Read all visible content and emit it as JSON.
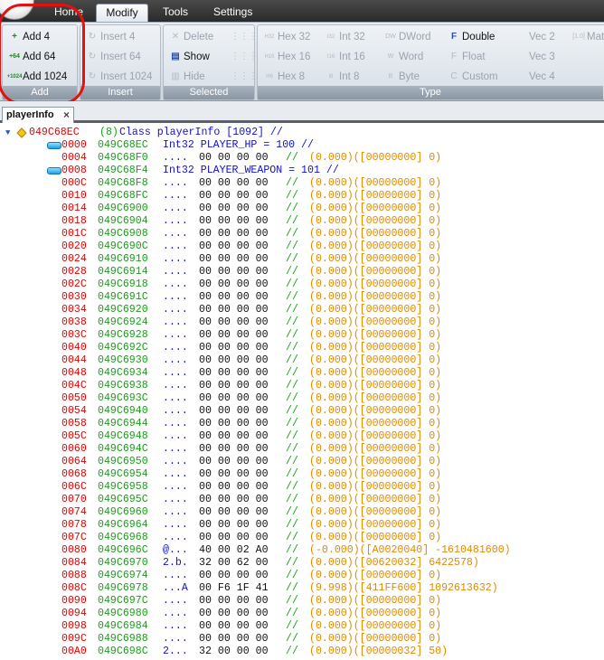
{
  "menu": {
    "tabs": [
      "Home",
      "Modify",
      "Tools",
      "Settings"
    ],
    "active": "Modify"
  },
  "ribbon": {
    "groups": {
      "add": "Add",
      "insert": "Insert",
      "selected": "Selected",
      "type": "Type"
    },
    "add": {
      "add4": "Add 4",
      "add64": "Add 64",
      "add1024": "Add 1024"
    },
    "insert": {
      "ins4": "Insert 4",
      "ins64": "Insert 64",
      "ins1024": "Insert 1024"
    },
    "selected": {
      "delete": "Delete",
      "show": "Show",
      "hide": "Hide"
    },
    "type": {
      "hex32": "Hex 32",
      "hex16": "Hex 16",
      "hex8": "Hex 8",
      "int32": "Int 32",
      "int16": "Int 16",
      "int8": "Int 8",
      "dword": "DWord",
      "word": "Word",
      "byte": "Byte",
      "double": "Double",
      "float": "Float",
      "custom": "Custom",
      "vec2": "Vec 2",
      "vec3": "Vec 3",
      "vec4": "Vec 4",
      "mat": "Mat"
    },
    "icons": {
      "add4": "+",
      "add64": "+64",
      "add1024": "+1024",
      "ins": "↻",
      "del": "✕",
      "show": "▤",
      "hide": "▥",
      "hex32": "H32",
      "hex16": "H16",
      "hex8": "H8",
      "int32": "I32",
      "int16": "I16",
      "int8": "I8",
      "dw": "DW",
      "w": "W",
      "b": "B",
      "dbl": "F",
      "flt": "F",
      "cus": "C"
    }
  },
  "document": {
    "tab": "playerInfo",
    "close": "×"
  },
  "header": {
    "address": "049C68EC",
    "count": "(8)",
    "text": "Class playerInfo [1092] //"
  },
  "named_rows": [
    {
      "offset": "0000",
      "addr": "049C68EC",
      "decl": "Int32 PLAYER_HP = 100 //"
    },
    {
      "offset": "0008",
      "addr": "049C68F4",
      "decl": "Int32 PLAYER_WEAPON = 101 //"
    }
  ],
  "rows": [
    {
      "o": "0004",
      "a": "049C68F0",
      "s": "....",
      "h": "00 00 00 00",
      "f": "(0.000)([00000000] 0)"
    },
    {
      "o": "000C",
      "a": "049C68F8",
      "s": "....",
      "h": "00 00 00 00",
      "f": "(0.000)([00000000] 0)"
    },
    {
      "o": "0010",
      "a": "049C68FC",
      "s": "....",
      "h": "00 00 00 00",
      "f": "(0.000)([00000000] 0)"
    },
    {
      "o": "0014",
      "a": "049C6900",
      "s": "....",
      "h": "00 00 00 00",
      "f": "(0.000)([00000000] 0)"
    },
    {
      "o": "0018",
      "a": "049C6904",
      "s": "....",
      "h": "00 00 00 00",
      "f": "(0.000)([00000000] 0)"
    },
    {
      "o": "001C",
      "a": "049C6908",
      "s": "....",
      "h": "00 00 00 00",
      "f": "(0.000)([00000000] 0)"
    },
    {
      "o": "0020",
      "a": "049C690C",
      "s": "....",
      "h": "00 00 00 00",
      "f": "(0.000)([00000000] 0)"
    },
    {
      "o": "0024",
      "a": "049C6910",
      "s": "....",
      "h": "00 00 00 00",
      "f": "(0.000)([00000000] 0)"
    },
    {
      "o": "0028",
      "a": "049C6914",
      "s": "....",
      "h": "00 00 00 00",
      "f": "(0.000)([00000000] 0)"
    },
    {
      "o": "002C",
      "a": "049C6918",
      "s": "....",
      "h": "00 00 00 00",
      "f": "(0.000)([00000000] 0)"
    },
    {
      "o": "0030",
      "a": "049C691C",
      "s": "....",
      "h": "00 00 00 00",
      "f": "(0.000)([00000000] 0)"
    },
    {
      "o": "0034",
      "a": "049C6920",
      "s": "....",
      "h": "00 00 00 00",
      "f": "(0.000)([00000000] 0)"
    },
    {
      "o": "0038",
      "a": "049C6924",
      "s": "....",
      "h": "00 00 00 00",
      "f": "(0.000)([00000000] 0)"
    },
    {
      "o": "003C",
      "a": "049C6928",
      "s": "....",
      "h": "00 00 00 00",
      "f": "(0.000)([00000000] 0)"
    },
    {
      "o": "0040",
      "a": "049C692C",
      "s": "....",
      "h": "00 00 00 00",
      "f": "(0.000)([00000000] 0)"
    },
    {
      "o": "0044",
      "a": "049C6930",
      "s": "....",
      "h": "00 00 00 00",
      "f": "(0.000)([00000000] 0)"
    },
    {
      "o": "0048",
      "a": "049C6934",
      "s": "....",
      "h": "00 00 00 00",
      "f": "(0.000)([00000000] 0)"
    },
    {
      "o": "004C",
      "a": "049C6938",
      "s": "....",
      "h": "00 00 00 00",
      "f": "(0.000)([00000000] 0)"
    },
    {
      "o": "0050",
      "a": "049C693C",
      "s": "....",
      "h": "00 00 00 00",
      "f": "(0.000)([00000000] 0)"
    },
    {
      "o": "0054",
      "a": "049C6940",
      "s": "....",
      "h": "00 00 00 00",
      "f": "(0.000)([00000000] 0)"
    },
    {
      "o": "0058",
      "a": "049C6944",
      "s": "....",
      "h": "00 00 00 00",
      "f": "(0.000)([00000000] 0)"
    },
    {
      "o": "005C",
      "a": "049C6948",
      "s": "....",
      "h": "00 00 00 00",
      "f": "(0.000)([00000000] 0)"
    },
    {
      "o": "0060",
      "a": "049C694C",
      "s": "....",
      "h": "00 00 00 00",
      "f": "(0.000)([00000000] 0)"
    },
    {
      "o": "0064",
      "a": "049C6950",
      "s": "....",
      "h": "00 00 00 00",
      "f": "(0.000)([00000000] 0)"
    },
    {
      "o": "0068",
      "a": "049C6954",
      "s": "....",
      "h": "00 00 00 00",
      "f": "(0.000)([00000000] 0)"
    },
    {
      "o": "006C",
      "a": "049C6958",
      "s": "....",
      "h": "00 00 00 00",
      "f": "(0.000)([00000000] 0)"
    },
    {
      "o": "0070",
      "a": "049C695C",
      "s": "....",
      "h": "00 00 00 00",
      "f": "(0.000)([00000000] 0)"
    },
    {
      "o": "0074",
      "a": "049C6960",
      "s": "....",
      "h": "00 00 00 00",
      "f": "(0.000)([00000000] 0)"
    },
    {
      "o": "0078",
      "a": "049C6964",
      "s": "....",
      "h": "00 00 00 00",
      "f": "(0.000)([00000000] 0)"
    },
    {
      "o": "007C",
      "a": "049C6968",
      "s": "....",
      "h": "00 00 00 00",
      "f": "(0.000)([00000000] 0)"
    },
    {
      "o": "0080",
      "a": "049C696C",
      "s": "@...",
      "h": "40 00 02 A0",
      "f": "(-0.000)([A0020040] -1610481600)"
    },
    {
      "o": "0084",
      "a": "049C6970",
      "s": "2.b.",
      "h": "32 00 62 00",
      "f": "(0.000)([00620032] 6422578)"
    },
    {
      "o": "0088",
      "a": "049C6974",
      "s": "....",
      "h": "00 00 00 00",
      "f": "(0.000)([00000000] 0)"
    },
    {
      "o": "008C",
      "a": "049C6978",
      "s": "...A",
      "h": "00 F6 1F 41",
      "f": "(9.998)([411FF600] 1092613632)"
    },
    {
      "o": "0090",
      "a": "049C697C",
      "s": "....",
      "h": "00 00 00 00",
      "f": "(0.000)([00000000] 0)"
    },
    {
      "o": "0094",
      "a": "049C6980",
      "s": "....",
      "h": "00 00 00 00",
      "f": "(0.000)([00000000] 0)"
    },
    {
      "o": "0098",
      "a": "049C6984",
      "s": "....",
      "h": "00 00 00 00",
      "f": "(0.000)([00000000] 0)"
    },
    {
      "o": "009C",
      "a": "049C6988",
      "s": "....",
      "h": "00 00 00 00",
      "f": "(0.000)([00000000] 0)"
    },
    {
      "o": "00A0",
      "a": "049C698C",
      "s": "2...",
      "h": "32 00 00 00",
      "f": "(0.000)([00000032] 50)"
    }
  ],
  "comment": "//"
}
